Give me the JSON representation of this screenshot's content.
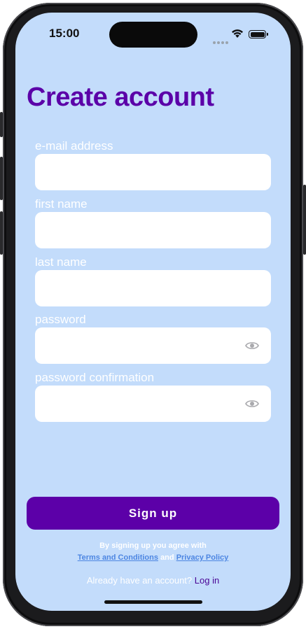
{
  "status_bar": {
    "time": "15:00"
  },
  "page": {
    "title": "Create account"
  },
  "form": {
    "email_label": "e-mail address",
    "email_value": "",
    "first_name_label": "first name",
    "first_name_value": "",
    "last_name_label": "last name",
    "last_name_value": "",
    "password_label": "password",
    "password_value": "",
    "password_confirmation_label": "password confirmation",
    "password_confirmation_value": ""
  },
  "actions": {
    "signup_label": "Sign up"
  },
  "terms": {
    "line1": "By signing up you agree with",
    "terms_link": "Terms and Conditions",
    "and": "and",
    "privacy_link": "Privacy Policy"
  },
  "login": {
    "prompt": "Already have an account?",
    "link": "Log in"
  },
  "colors": {
    "background": "#c3dcfb",
    "accent": "#5c00a8",
    "link": "#4d86e2"
  },
  "icons": {
    "password_toggle": "eye-icon",
    "wifi": "wifi-icon",
    "battery": "battery-icon"
  }
}
